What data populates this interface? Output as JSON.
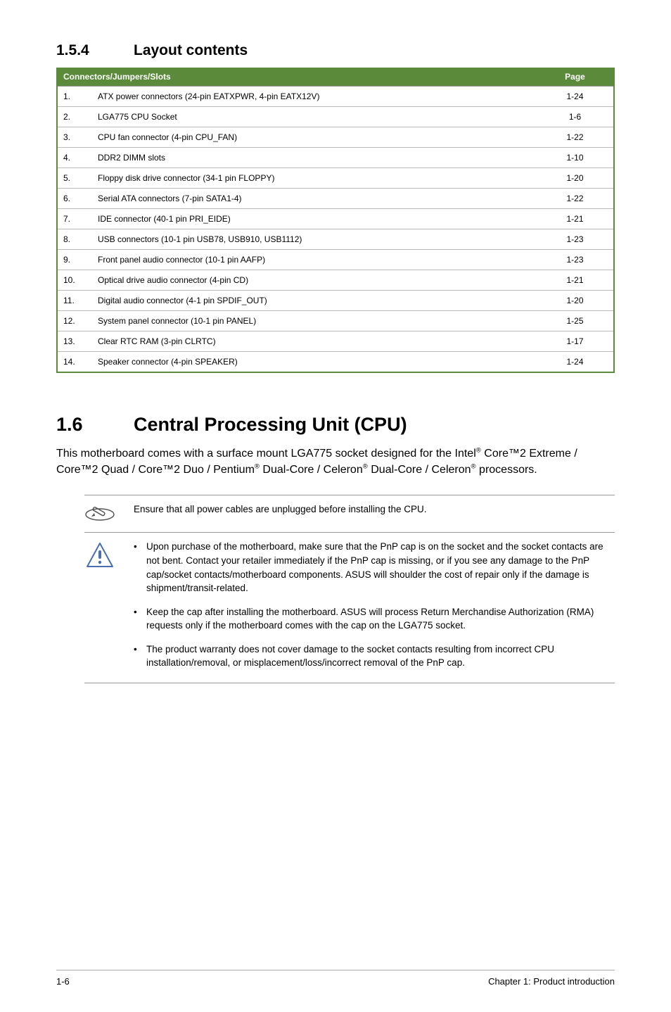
{
  "subsection": {
    "number": "1.5.4",
    "title": "Layout contents"
  },
  "table": {
    "header": {
      "main": "Connectors/Jumpers/Slots",
      "page": "Page"
    },
    "rows": [
      {
        "n": "1.",
        "desc": "ATX power connectors (24-pin EATXPWR, 4-pin EATX12V)",
        "p": "1-24"
      },
      {
        "n": "2.",
        "desc": "LGA775 CPU Socket",
        "p": "1-6"
      },
      {
        "n": "3.",
        "desc": "CPU fan connector (4-pin CPU_FAN)",
        "p": "1-22"
      },
      {
        "n": "4.",
        "desc": "DDR2 DIMM slots",
        "p": "1-10"
      },
      {
        "n": "5.",
        "desc": "Floppy disk drive connector (34-1 pin FLOPPY)",
        "p": "1-20"
      },
      {
        "n": "6.",
        "desc": "Serial ATA connectors (7-pin SATA1-4)",
        "p": "1-22"
      },
      {
        "n": "7.",
        "desc": "IDE connector (40-1 pin PRI_EIDE)",
        "p": "1-21"
      },
      {
        "n": "8.",
        "desc": "USB connectors (10-1 pin USB78, USB910, USB1112)",
        "p": "1-23"
      },
      {
        "n": "9.",
        "desc": "Front panel audio connector (10-1 pin AAFP)",
        "p": "1-23"
      },
      {
        "n": "10.",
        "desc": "Optical drive audio connector (4-pin CD)",
        "p": "1-21"
      },
      {
        "n": "11.",
        "desc": "Digital audio connector (4-1 pin SPDIF_OUT)",
        "p": "1-20"
      },
      {
        "n": "12.",
        "desc": "System panel connector (10-1 pin PANEL)",
        "p": "1-25"
      },
      {
        "n": "13.",
        "desc": "Clear RTC RAM (3-pin CLRTC)",
        "p": "1-17"
      },
      {
        "n": "14.",
        "desc": "Speaker connector (4-pin SPEAKER)",
        "p": "1-24"
      }
    ]
  },
  "section": {
    "number": "1.6",
    "title": "Central Processing Unit (CPU)"
  },
  "intro": {
    "part1": "This motherboard comes with a surface mount LGA775 socket designed for the Intel",
    "reg1": "®",
    "part2": " Core™2 Extreme / Core™2 Quad / Core™2 Duo / Pentium",
    "reg2": "®",
    "part3": " Dual-Core / Celeron",
    "reg3": "®",
    "part4": " Dual-Core / Celeron",
    "reg4": "®",
    "part5": " processors."
  },
  "note1": "Ensure that all power cables are unplugged before installing the CPU.",
  "bullets": [
    "Upon purchase of the motherboard, make sure that the PnP cap is on the socket and the socket contacts are not bent. Contact your retailer immediately if the PnP cap is missing, or if you see any damage to the PnP cap/socket contacts/motherboard components. ASUS will shoulder the cost of repair only if the damage is shipment/transit-related.",
    "Keep the cap after installing the motherboard. ASUS will process Return Merchandise Authorization (RMA) requests only if the motherboard comes with the cap on the LGA775 socket.",
    "The product warranty does not cover damage to the socket contacts resulting from incorrect CPU installation/removal, or misplacement/loss/incorrect removal of the PnP cap."
  ],
  "footer": {
    "left": "1-6",
    "right": "Chapter 1: Product introduction"
  }
}
